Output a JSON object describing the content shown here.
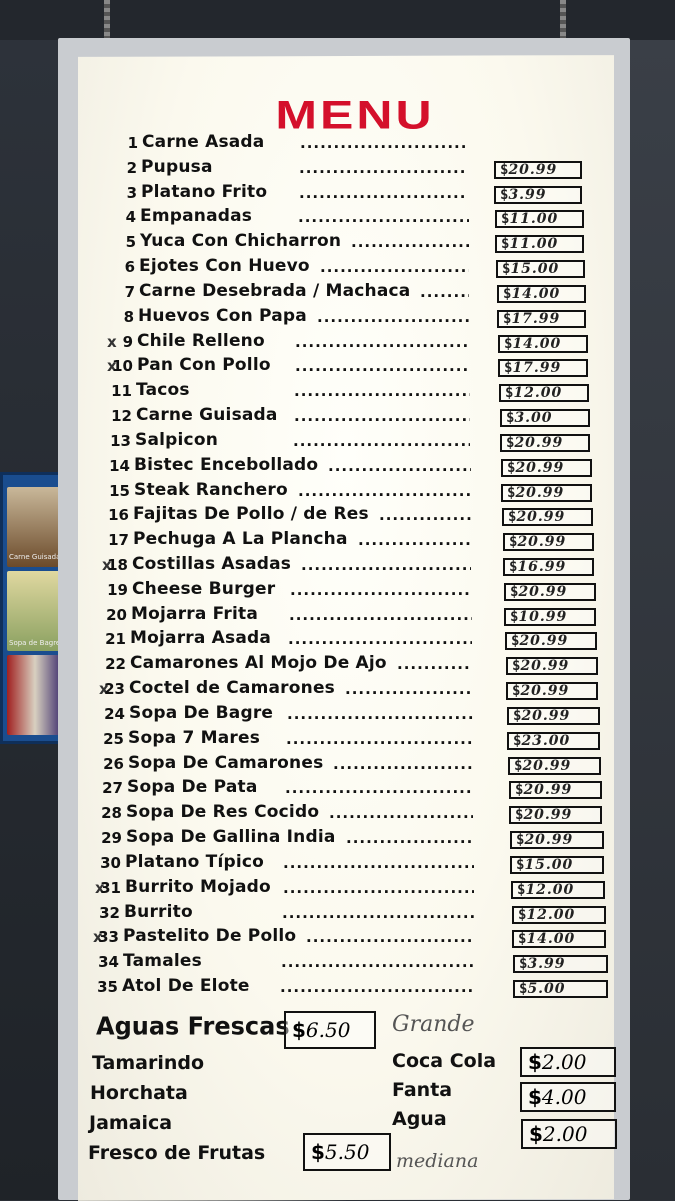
{
  "title": "MENU",
  "items": [
    {
      "num": "1",
      "name": "Carne Asada",
      "price": null,
      "mark": ""
    },
    {
      "num": "2",
      "name": "Pupusa",
      "price": "20.99",
      "mark": ""
    },
    {
      "num": "3",
      "name": "Platano Frito",
      "price": "3.99",
      "mark": ""
    },
    {
      "num": "4",
      "name": "Empanadas",
      "price": "11.00",
      "mark": ""
    },
    {
      "num": "5",
      "name": "Yuca Con Chicharron",
      "price": "11.00",
      "mark": ""
    },
    {
      "num": "6",
      "name": "Ejotes Con Huevo",
      "price": "15.00",
      "mark": ""
    },
    {
      "num": "7",
      "name": "Carne Desebrada  /  Machaca",
      "price": "14.00",
      "mark": ""
    },
    {
      "num": "8",
      "name": "Huevos Con Papa",
      "price": "17.99",
      "mark": ""
    },
    {
      "num": "9",
      "name": "Chile Relleno",
      "price": "14.00",
      "mark": "x"
    },
    {
      "num": "10",
      "name": "Pan Con Pollo",
      "price": "17.99",
      "mark": "x"
    },
    {
      "num": "11",
      "name": "Tacos",
      "price": "12.00",
      "mark": ""
    },
    {
      "num": "12",
      "name": "Carne Guisada",
      "price": "3.00",
      "mark": ""
    },
    {
      "num": "13",
      "name": "Salpicon",
      "price": "20.99",
      "mark": ""
    },
    {
      "num": "14",
      "name": "Bistec Encebollado",
      "price": "20.99",
      "mark": ""
    },
    {
      "num": "15",
      "name": "Steak Ranchero",
      "price": "20.99",
      "mark": ""
    },
    {
      "num": "16",
      "name": "Fajitas De Pollo  /  de Res",
      "price": "20.99",
      "mark": ""
    },
    {
      "num": "17",
      "name": "Pechuga A La Plancha",
      "price": "20.99",
      "mark": ""
    },
    {
      "num": "18",
      "name": "Costillas Asadas",
      "price": "16.99",
      "mark": "x"
    },
    {
      "num": "19",
      "name": "Cheese Burger",
      "price": "20.99",
      "mark": ""
    },
    {
      "num": "20",
      "name": "Mojarra Frita",
      "price": "10.99",
      "mark": ""
    },
    {
      "num": "21",
      "name": "Mojarra Asada",
      "price": "20.99",
      "mark": ""
    },
    {
      "num": "22",
      "name": "Camarones Al Mojo De Ajo",
      "price": "20.99",
      "mark": ""
    },
    {
      "num": "23",
      "name": "Coctel de Camarones",
      "price": "20.99",
      "mark": "x"
    },
    {
      "num": "24",
      "name": "Sopa De Bagre",
      "price": "20.99",
      "mark": ""
    },
    {
      "num": "25",
      "name": "Sopa 7 Mares",
      "price": "23.00",
      "mark": ""
    },
    {
      "num": "26",
      "name": "Sopa De Camarones",
      "price": "20.99",
      "mark": ""
    },
    {
      "num": "27",
      "name": "Sopa De Pata",
      "price": "20.99",
      "mark": ""
    },
    {
      "num": "28",
      "name": "Sopa De Res Cocido",
      "price": "20.99",
      "mark": ""
    },
    {
      "num": "29",
      "name": "Sopa De Gallina India",
      "price": "20.99",
      "mark": ""
    },
    {
      "num": "30",
      "name": "Platano Típico",
      "price": "15.00",
      "mark": ""
    },
    {
      "num": "31",
      "name": "Burrito Mojado",
      "price": "12.00",
      "mark": "x"
    },
    {
      "num": "32",
      "name": "Burrito",
      "price": "12.00",
      "mark": ""
    },
    {
      "num": "33",
      "name": "Pastelito De Pollo",
      "price": "14.00",
      "mark": "x"
    },
    {
      "num": "34",
      "name": "Tamales",
      "price": "3.99",
      "mark": ""
    },
    {
      "num": "35",
      "name": "Atol De Elote",
      "price": "5.00",
      "mark": ""
    }
  ],
  "aguas": {
    "title": "Aguas Frescas",
    "price": "6.50",
    "grande": "Grande",
    "flavors": [
      "Tamarindo",
      "Horchata",
      "Jamaica"
    ],
    "frutas": "Fresco de Frutas",
    "frutas_price": "5.50",
    "mediana": "mediana"
  },
  "drinks": [
    {
      "name": "Coca Cola",
      "price": "2.00"
    },
    {
      "name": "Fanta",
      "price": "4.00"
    },
    {
      "name": "Agua",
      "price": "2.00"
    }
  ],
  "currency": "$",
  "tv": {
    "labels": [
      "Carne Guisada",
      "Sopa de Bagre"
    ]
  },
  "colors": {
    "title": "#d4102b",
    "board": "#fbf9ee"
  }
}
